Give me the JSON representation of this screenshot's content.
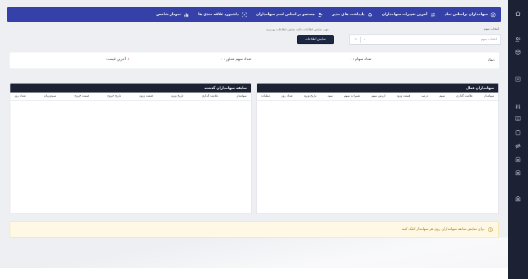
{
  "nav": {
    "items": [
      {
        "label": "سهامداران براساس نماد",
        "icon": "user-circle-icon"
      },
      {
        "label": "آخرین تغییرات سهامداران",
        "icon": "swap-icon"
      },
      {
        "label": "یادداشت های مدیر",
        "icon": "bell-icon"
      },
      {
        "label": "جستجو بر اساس اسم سهامداران",
        "icon": "user-search-icon"
      },
      {
        "label": "داشبورد علاقه مندی ها",
        "icon": "scan-icon"
      },
      {
        "label": "نمودار شاخص",
        "icon": "bar-chart-icon"
      }
    ]
  },
  "selection": {
    "label": "انتخاب سهم",
    "placeholder": "انتخاب سهم",
    "hint": "جهت نمایش اطلاعات دکمه نمایش اطلاعات رو بزنید",
    "button": "نمایش اطلاعات"
  },
  "summary": {
    "symbol_label": "نماد:",
    "shares_label": "تعداد سهام :",
    "shares_value": "۰",
    "floating_label": "تعداد سهم شناور :",
    "floating_value": "۰",
    "last_price_label": "آخرین قیمت:",
    "last_price_value": "۰ ↓"
  },
  "active_table": {
    "title": "سهامداران فعال",
    "columns": [
      "سهامدار",
      "علامت گذاری",
      "سهم",
      "درصد",
      "قیمت ورود",
      "ارزش سهم",
      "تغییرات سهم",
      "سود",
      "تاریخ ورود",
      "تعداد روز",
      "عملیات"
    ]
  },
  "history_table": {
    "title": "سابقه سهامداران گذشته",
    "columns": [
      "سهامدار",
      "علامت گذاری",
      "تاریخ ورود",
      "قیمت ورود",
      "تاریخ خروج",
      "قیمت خروج",
      "سودوزیان",
      "تعداد روز"
    ]
  },
  "alert": {
    "text": "برای نمایش سابقه سهامداران روی هر سهامدار کلیک کنید"
  },
  "rail_icons": [
    "home-icon",
    "users-icon",
    "cube-icon",
    "plus-square-icon",
    "sliders-icon",
    "book-icon",
    "clipboard-icon",
    "eye-slash-icon",
    "building-icon",
    "building-icon",
    "building-icon"
  ]
}
